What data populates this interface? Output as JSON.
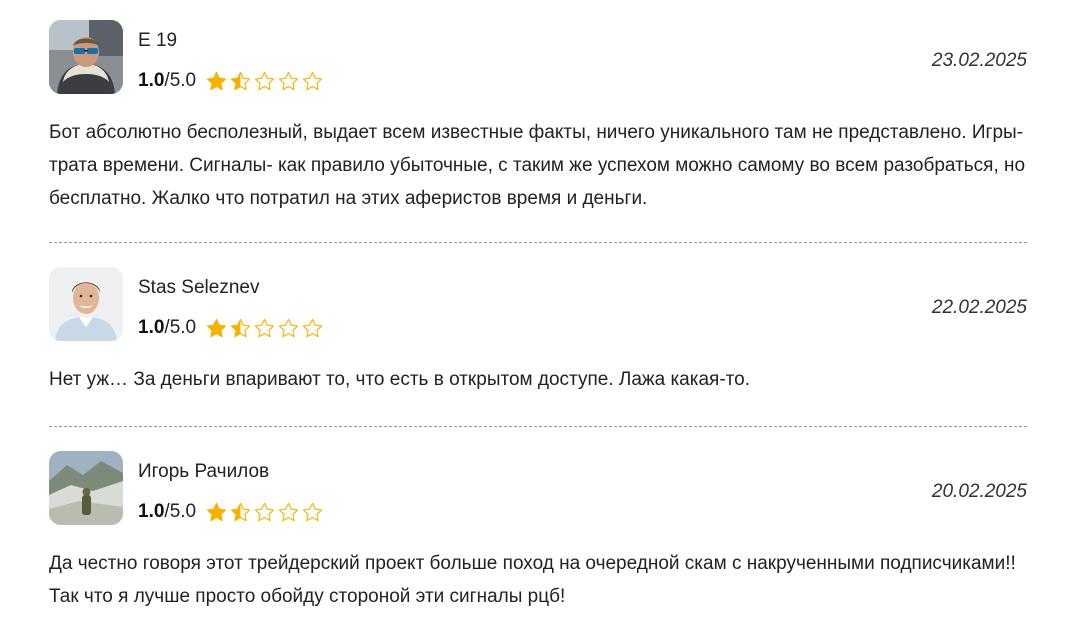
{
  "colors": {
    "star_filled": "#F5B301",
    "star_outline": "#F5B301",
    "divider": "#9A9A9A"
  },
  "reviews": [
    {
      "author": "E 19",
      "score": "1.0",
      "max": "/5.0",
      "stars_filled_fraction": 0.3,
      "date": "23.02.2025",
      "text": "Бот абсолютно бесполезный, выдает всем известные факты, ничего уникального там не представлено. Игры- трата времени. Сигналы- как правило убыточные, с таким же успехом можно самому во всем разобраться, но бесплатно. Жалко что потратил на этих аферистов время и деньги."
    },
    {
      "author": "Stas Seleznev",
      "score": "1.0",
      "max": "/5.0",
      "stars_filled_fraction": 0.3,
      "date": "22.02.2025",
      "text": "Нет уж… За деньги впаривают то, что есть в открытом доступе. Лажа какая-то."
    },
    {
      "author": "Игорь Рачилов",
      "score": "1.0",
      "max": "/5.0",
      "stars_filled_fraction": 0.3,
      "date": "20.02.2025",
      "text": "Да честно говоря этот трейдерский проект больше поход на очередной скам с накрученными подписчиками!! Так что я лучше просто обойду стороной эти сигналы рцб!"
    }
  ]
}
